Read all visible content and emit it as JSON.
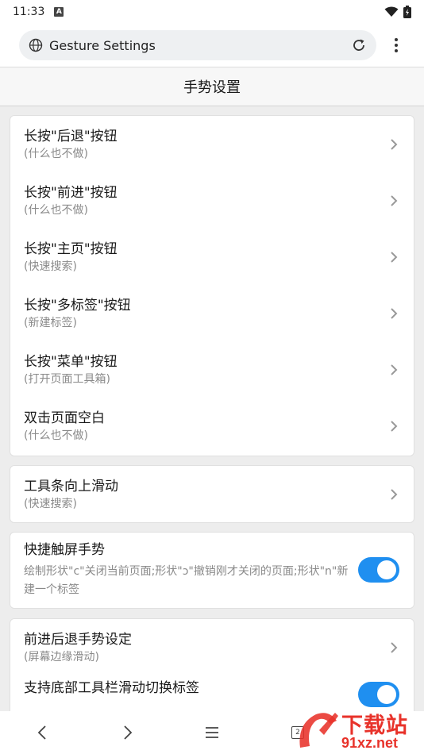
{
  "status": {
    "time": "11:33",
    "notif_letter": "A"
  },
  "address": {
    "title": "Gesture Settings"
  },
  "page": {
    "title": "手势设置"
  },
  "group1": [
    {
      "label": "长按\"后退\"按钮",
      "sub": "(什么也不做)"
    },
    {
      "label": "长按\"前进\"按钮",
      "sub": "(什么也不做)"
    },
    {
      "label": "长按\"主页\"按钮",
      "sub": "(快速搜索)"
    },
    {
      "label": "长按\"多标签\"按钮",
      "sub": "(新建标签)"
    },
    {
      "label": "长按\"菜单\"按钮",
      "sub": "(打开页面工具箱)"
    },
    {
      "label": "双击页面空白",
      "sub": "(什么也不做)"
    }
  ],
  "group2": {
    "label": "工具条向上滑动",
    "sub": "(快速搜索)"
  },
  "group3": {
    "label": "快捷触屏手势",
    "sub": "绘制形状\"c\"关闭当前页面;形状\"ɔ\"撤销刚才关闭的页面;形状\"n\"新建一个标签",
    "toggle_on": true
  },
  "group4": [
    {
      "label": "前进后退手势设定",
      "sub": "(屏幕边缘滑动)"
    },
    {
      "label": "支持底部工具栏滑动切换标签",
      "toggle_on": true
    }
  ],
  "watermark": {
    "text_top": "下载站",
    "text_bottom": "91xz.net",
    "tab_count": "2"
  },
  "colors": {
    "accent": "#1f8ff0",
    "watermark": "#e8322a"
  }
}
